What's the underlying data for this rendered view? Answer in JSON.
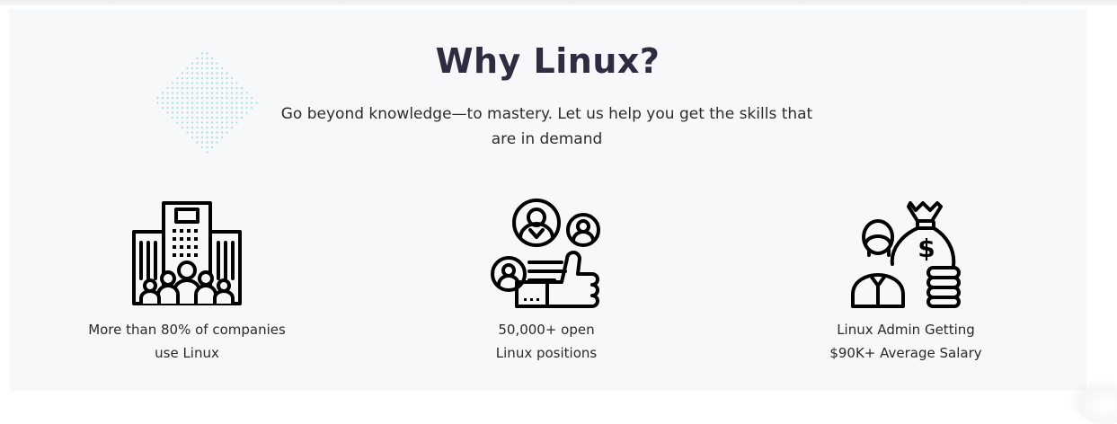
{
  "section": {
    "title": "Why Linux?",
    "subtitle": "Go beyond knowledge—to mastery. Let us help you get the skills that are in demand"
  },
  "features": [
    {
      "icon": "company-building-icon",
      "line1": "More than 80% of companies",
      "line2": "use Linux"
    },
    {
      "icon": "job-candidates-icon",
      "line1": "50,000+ open",
      "line2": "Linux positions"
    },
    {
      "icon": "salary-money-bag-icon",
      "line1": "Linux Admin Getting",
      "line2": "$90K+ Average Salary"
    }
  ],
  "colors": {
    "section_background": "#f7f8fa",
    "title": "#2d2c40",
    "text": "#2a2a2a",
    "dot_pattern": "#a8dde0",
    "icon_stroke": "#000000"
  }
}
